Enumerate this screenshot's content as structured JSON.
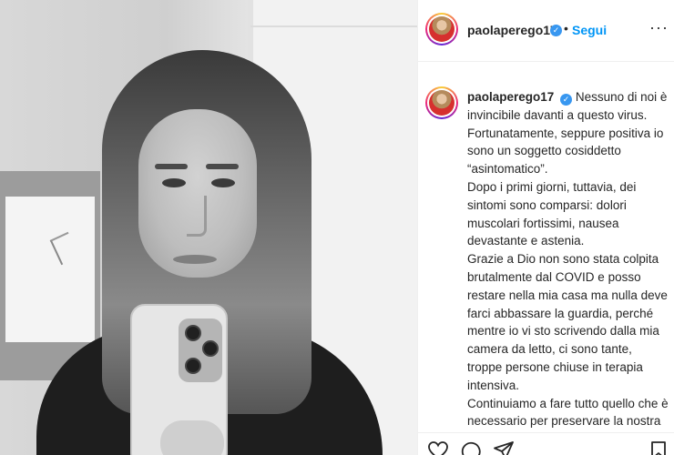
{
  "post": {
    "header": {
      "username": "paolaperego17",
      "verified_glyph": "✓",
      "separator": "•",
      "follow_label": "Segui",
      "more_glyph": "···"
    },
    "caption": {
      "username": "paolaperego17",
      "verified_glyph": "✓",
      "paragraphs": [
        "Nessuno di noi è invincibile davanti a questo virus. Fortunatamente, seppure positiva io sono un soggetto cosiddetto “asintomatico”.",
        "Dopo i primi giorni, tuttavia, dei sintomi sono comparsi: dolori muscolari fortissimi, nausea devastante e astenia.",
        "Grazie a Dio non sono stata colpita brutalmente dal COVID e posso restare nella mia casa ma nulla deve farci abbassare la guardia, perché mentre io vi sto scrivendo dalla mia camera da letto, ci sono tante, troppe persone chiuse in terapia intensiva.",
        "Continuiamo a fare tutto quello che è necessario per preservare la nostra"
      ]
    },
    "icons": [
      "heart-icon",
      "comment-icon",
      "share-icon",
      "bookmark-icon",
      "verified-badge-icon",
      "more-options-icon"
    ],
    "colors": {
      "link": "#0095f6",
      "verified": "#3897f0",
      "text": "#262626"
    }
  }
}
